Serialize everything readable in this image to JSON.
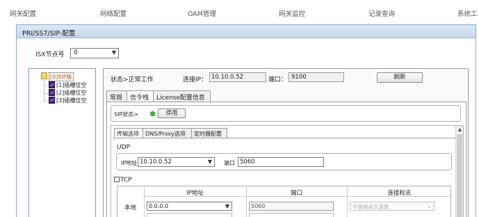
{
  "topnav": {
    "items": [
      "网关配置",
      "网络配置",
      "OAM管理",
      "网关监控",
      "记录查询",
      "系统工"
    ]
  },
  "dialog": {
    "title": "PRI/SS7/SIP-配置",
    "isx": {
      "label": "ISX节点号",
      "value": "0"
    }
  },
  "tree": {
    "items": [
      "[0]SIP板",
      "[1]插槽位空",
      "[2]插槽位空",
      "[3]插槽位空"
    ]
  },
  "status": {
    "text": "状态>正常工作",
    "conn_label": "连接IP：",
    "conn_ip": "10.10.0.52",
    "port_label": "端口：",
    "port_value": "9100",
    "refresh_label": "刷新"
  },
  "tabs": [
    "常规",
    "信令栈",
    "License配置信息"
  ],
  "sip": {
    "status_label": "SIP状态>",
    "stop_label": "停用"
  },
  "subtabs": [
    "传输选项",
    "DNS/Proxy选项",
    "定时器配置"
  ],
  "udp": {
    "label": "UDP",
    "ip_label": "IP地址",
    "ip_value": "10.10.0.52",
    "port_label": "端口",
    "port_value": "5060"
  },
  "tcp": {
    "label": "TCP",
    "columns": [
      "IP地址",
      "端口",
      "连接标志"
    ],
    "local_label": "本地",
    "local_ip": "0.0.0.0",
    "local_port": "5060",
    "local_flag": "不使用永久连接"
  }
}
